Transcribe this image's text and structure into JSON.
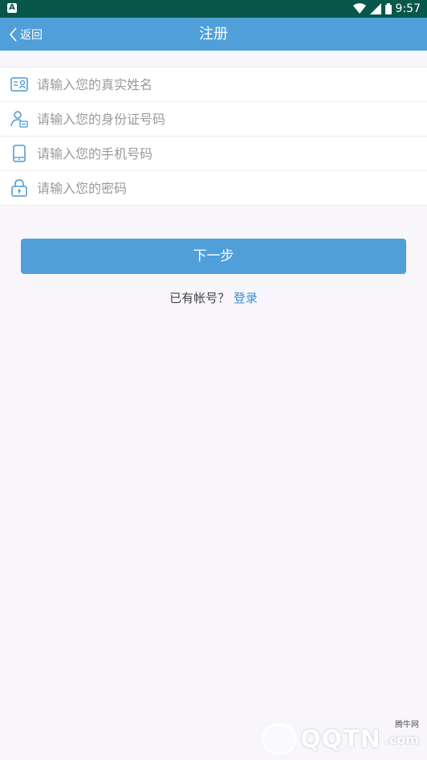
{
  "status_bar": {
    "notification_icon": "A",
    "time": "9:57"
  },
  "header": {
    "back_label": "返回",
    "title": "注册"
  },
  "form": {
    "name_placeholder": "请输入您的真实姓名",
    "id_placeholder": "请输入您的身份证号码",
    "phone_placeholder": "请输入您的手机号码",
    "password_placeholder": "请输入您的密码"
  },
  "actions": {
    "next_label": "下一步",
    "has_account_text": "已有帐号？",
    "login_link": "登录"
  },
  "watermark": {
    "brand": "QQTN",
    "suffix": ".com",
    "cn_name": "腾牛网"
  },
  "colors": {
    "status_bar": "#07574a",
    "header": "#519fd9",
    "accent": "#519fd9",
    "link": "#3a8fd1",
    "background": "#f8f6fb",
    "icon": "#4a9ad4"
  }
}
